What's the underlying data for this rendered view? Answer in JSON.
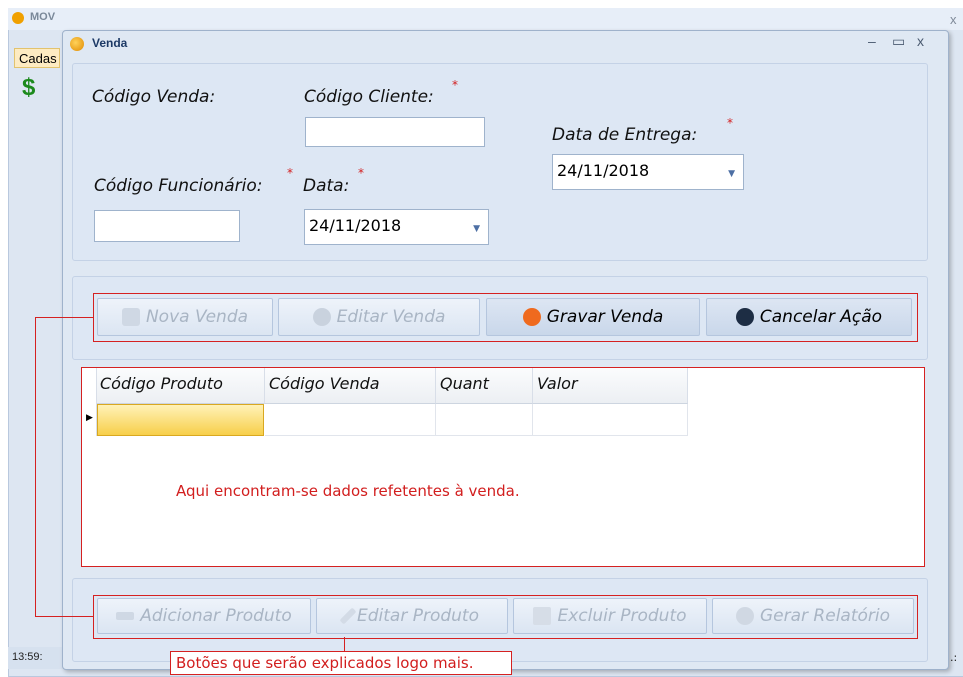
{
  "background_app": {
    "title": "MOV",
    "tab_label": "Cadas",
    "dollar_icon": "$",
    "status_time": "13:59:",
    "status_right": ".:",
    "close_glyph": "x"
  },
  "window": {
    "title": "Venda",
    "controls": {
      "minimize": "–",
      "maximize": "▭",
      "close": "x"
    }
  },
  "form": {
    "codigo_venda_label": "Código Venda:",
    "codigo_cliente_label": "Código Cliente:",
    "codigo_cliente_value": "",
    "data_entrega_label": "Data de Entrega:",
    "data_entrega_value": "24/11/2018",
    "codigo_funcionario_label": "Código Funcionário:",
    "codigo_funcionario_value": "",
    "data_label": "Data:",
    "data_value": "24/11/2018",
    "required_mark": "*"
  },
  "actions": {
    "nova_venda": "Nova Venda",
    "editar_venda": "Editar Venda",
    "gravar_venda": "Gravar Venda",
    "cancelar_acao": "Cancelar Ação"
  },
  "grid": {
    "columns": [
      "Código Produto",
      "Código Venda",
      "Quant",
      "Valor"
    ],
    "rows": [
      [
        "",
        "",
        "",
        ""
      ]
    ]
  },
  "item_actions": {
    "adicionar_produto": "Adicionar Produto",
    "editar_produto": "Editar Produto",
    "excluir_produto": "Excluir Produto",
    "gerar_relatorio": "Gerar Relatório"
  },
  "annotations": {
    "grid_note": "Aqui encontram-se dados refetentes à venda.",
    "buttons_note": "Botões que serão explicados logo mais."
  },
  "colors": {
    "annotation_red": "#d21e1e",
    "gravar_icon": "#ef6a1e",
    "cancelar_icon": "#1d2d44",
    "selected_cell": "#f7cf4a"
  },
  "icons": {
    "nova_venda": "document-edit-icon",
    "editar_venda": "pencil-cup-icon",
    "gravar_venda": "folder-save-icon",
    "cancelar_acao": "trash-icon",
    "adicionar_produto": "add-line-icon",
    "editar_produto": "pencil-icon",
    "excluir_produto": "bin-icon",
    "gerar_relatorio": "report-icon"
  }
}
